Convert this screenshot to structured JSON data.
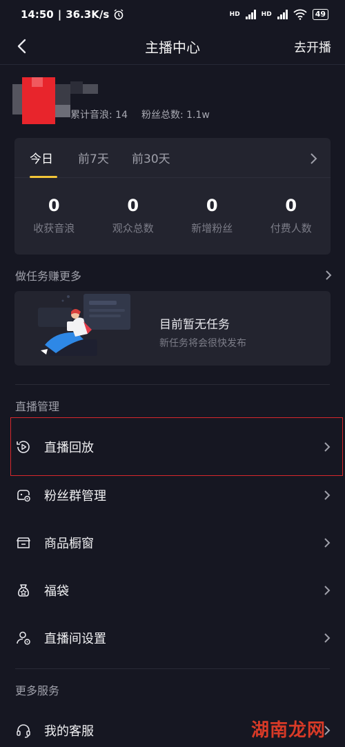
{
  "status_bar": {
    "time": "14:50",
    "network_speed": "36.3K/s",
    "battery": "49",
    "signal_label": "HD"
  },
  "nav": {
    "title": "主播中心",
    "action": "去开播"
  },
  "profile": {
    "cumulative_label": "累计音浪: 14",
    "fans_label": "粉丝总数: 1.1w"
  },
  "stats": {
    "tabs": [
      {
        "label": "今日",
        "active": true
      },
      {
        "label": "前7天",
        "active": false
      },
      {
        "label": "前30天",
        "active": false
      }
    ],
    "metrics": [
      {
        "value": "0",
        "label": "收获音浪"
      },
      {
        "value": "0",
        "label": "观众总数"
      },
      {
        "value": "0",
        "label": "新增粉丝"
      },
      {
        "value": "0",
        "label": "付费人数"
      }
    ]
  },
  "tasks": {
    "section_title": "做任务赚更多",
    "empty_title": "目前暂无任务",
    "empty_subtitle": "新任务将会很快发布"
  },
  "live_management": {
    "section_title": "直播管理",
    "items": [
      {
        "label": "直播回放",
        "icon": "replay-icon"
      },
      {
        "label": "粉丝群管理",
        "icon": "fan-group-icon"
      },
      {
        "label": "商品橱窗",
        "icon": "showcase-icon"
      },
      {
        "label": "福袋",
        "icon": "lucky-bag-icon"
      },
      {
        "label": "直播间设置",
        "icon": "room-settings-icon"
      }
    ]
  },
  "more_services": {
    "section_title": "更多服务",
    "items": [
      {
        "label": "我的客服",
        "icon": "headset-icon"
      }
    ]
  },
  "watermark": "湖南龙网",
  "colors": {
    "background": "#161722",
    "card": "#23242f",
    "accent_underline": "#f3c538",
    "highlight_border": "#d8282d"
  }
}
